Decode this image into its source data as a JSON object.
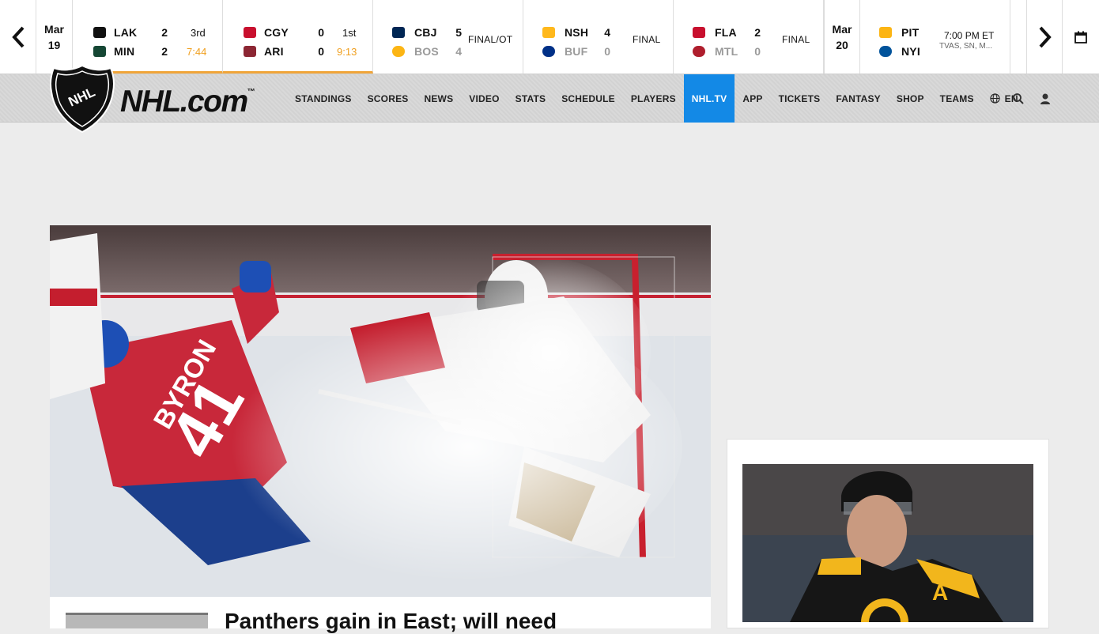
{
  "scoreboard": {
    "dates": [
      {
        "month": "Mar",
        "day": "19"
      },
      {
        "month": "Mar",
        "day": "20"
      }
    ],
    "games": [
      {
        "away": "LAK",
        "home": "MIN",
        "away_score": "2",
        "home_score": "2",
        "period": "3rd",
        "clock": "7:44",
        "away_color": "#111111",
        "home_color": "#154734"
      },
      {
        "away": "CGY",
        "home": "ARI",
        "away_score": "0",
        "home_score": "0",
        "period": "1st",
        "clock": "9:13",
        "away_color": "#c8102e",
        "home_color": "#8c2633"
      },
      {
        "away": "CBJ",
        "home": "BOS",
        "away_score": "5",
        "home_score": "4",
        "status": "FINAL/OT",
        "away_color": "#002654",
        "home_color": "#fcb514"
      },
      {
        "away": "NSH",
        "home": "BUF",
        "away_score": "4",
        "home_score": "0",
        "status": "FINAL",
        "away_color": "#ffb81c",
        "home_color": "#003087"
      },
      {
        "away": "FLA",
        "home": "MTL",
        "away_score": "2",
        "home_score": "0",
        "status": "FINAL",
        "away_color": "#c8102e",
        "home_color": "#af1e2d"
      },
      {
        "away": "PIT",
        "home": "NYI",
        "time": "7:00 PM ET",
        "network": "TVAS, SN, M...",
        "away_color": "#fcb514",
        "home_color": "#00539b"
      }
    ]
  },
  "brand": {
    "logo_text": "NHL.com",
    "tm": "™",
    "shield_text": "NHL"
  },
  "nav": {
    "items": [
      "STANDINGS",
      "SCORES",
      "NEWS",
      "VIDEO",
      "STATS",
      "SCHEDULE",
      "PLAYERS",
      "NHL.TV",
      "APP",
      "TICKETS",
      "FANTASY",
      "SHOP",
      "TEAMS"
    ],
    "active": "NHL.TV",
    "language": "EN",
    "accent": "#1389e6"
  },
  "hero": {
    "headline": "Panthers gain in East; will need",
    "jersey_name": "BYRON",
    "jersey_number": "41"
  },
  "side": {
    "captain_letter": "A"
  }
}
